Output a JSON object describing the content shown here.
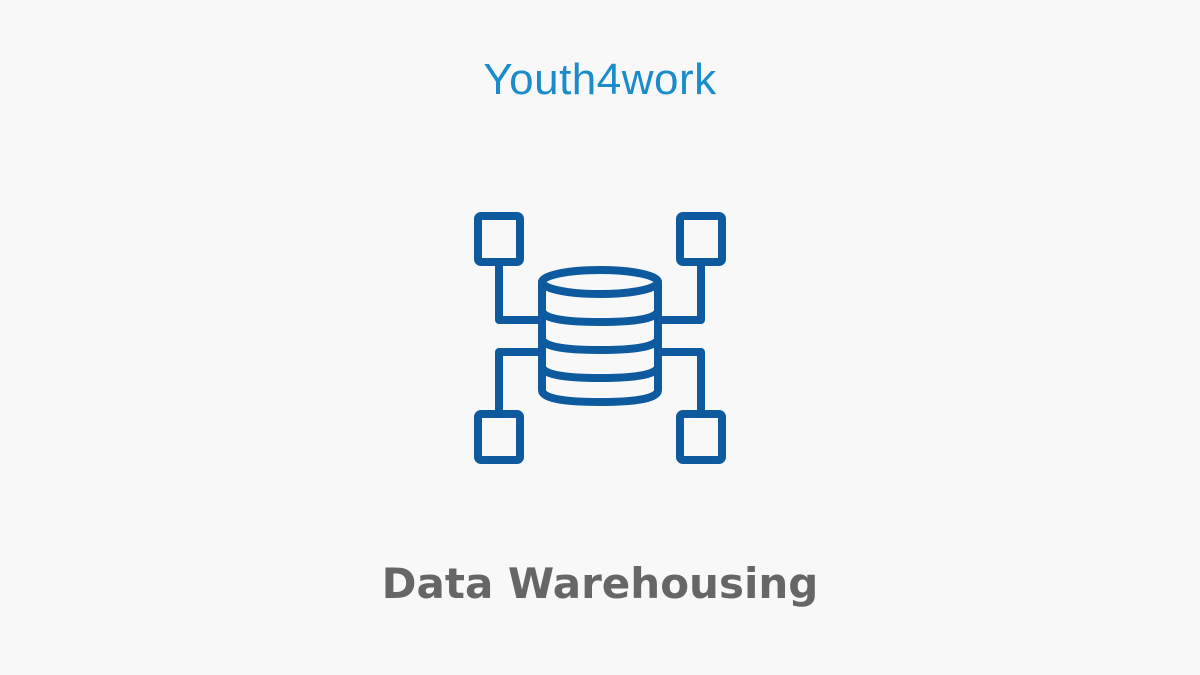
{
  "brand": {
    "name": "Youth4work",
    "color": "#1a8ccc"
  },
  "illustration": {
    "icon": "data-warehouse-icon",
    "color": "#0d5a9e"
  },
  "topic": {
    "title": "Data Warehousing",
    "color": "#666666"
  },
  "background": "#f8f8f8"
}
